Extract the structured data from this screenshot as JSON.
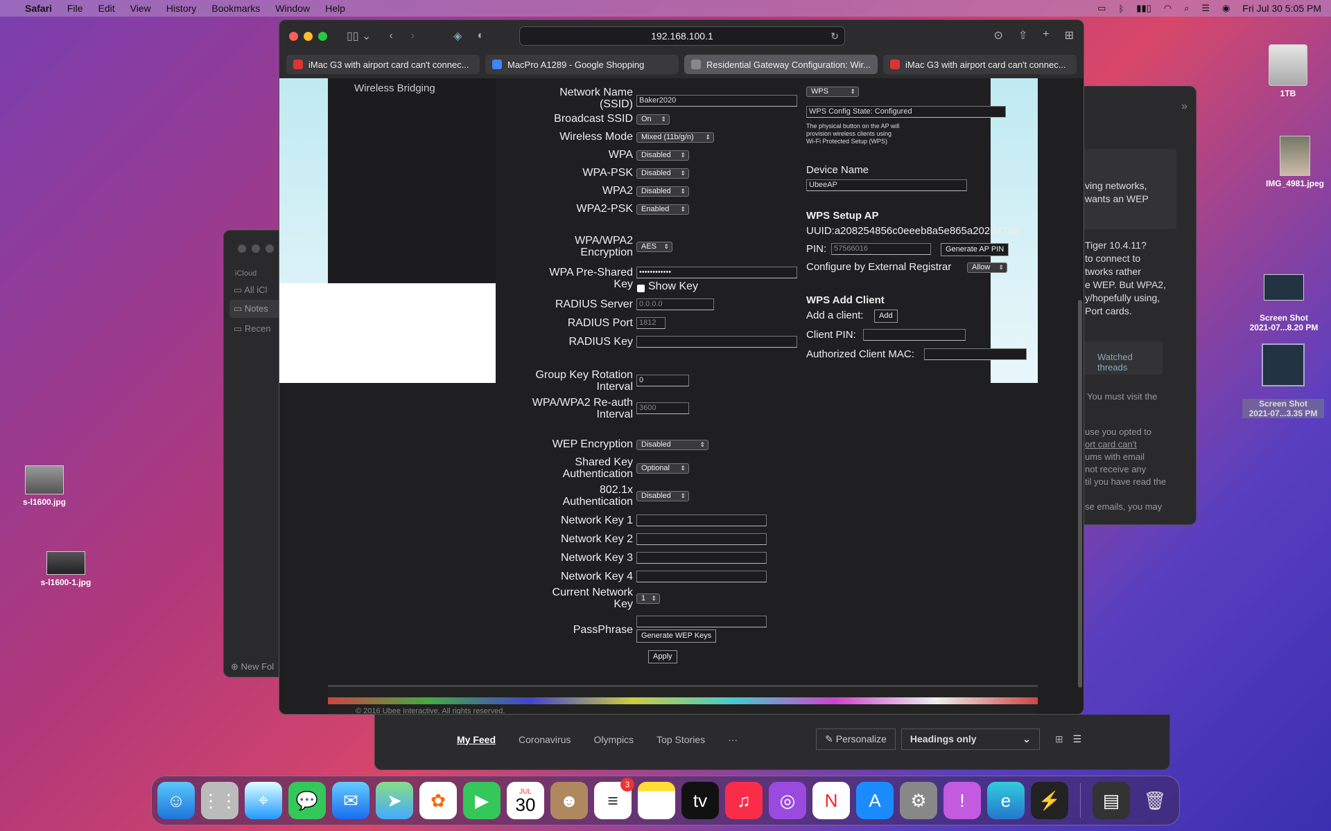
{
  "menubar": {
    "app": "Safari",
    "items": [
      "File",
      "Edit",
      "View",
      "History",
      "Bookmarks",
      "Window",
      "Help"
    ],
    "clock": "Fri Jul 30  5:05 PM"
  },
  "desktop": {
    "icons": [
      {
        "label": "1TB"
      },
      {
        "label": "IMG_4981.jpeg"
      },
      {
        "label": "Screen Shot\n2021-07...8.20 PM"
      },
      {
        "label": "Screen Shot\n2021-07...3.35 PM"
      },
      {
        "label": "s-l1600.jpg"
      },
      {
        "label": "s-l1600-1.jpg"
      }
    ]
  },
  "notes_window": {
    "section": "iCloud",
    "items": [
      "All iCl",
      "Notes",
      "Recen"
    ],
    "new_folder": "New Fol"
  },
  "forum_window": {
    "lines": [
      "ving networks,",
      "wants an WEP",
      "Tiger 10.4.11?",
      "to connect to",
      "tworks rather",
      "e WEP. But WPA2,",
      "y/hopefully using,",
      "Port cards.",
      "Watched threads",
      ". You must visit the",
      "use you opted to",
      "ort card can't",
      "ums with email",
      "not receive any",
      "til you have read the",
      "se emails, you may"
    ]
  },
  "safari": {
    "url": "192.168.100.1",
    "tabs": [
      {
        "title": "iMac G3 with airport card can't connec...",
        "fav": "#d33"
      },
      {
        "title": "MacPro A1289 - Google Shopping",
        "fav": "#4285f4"
      },
      {
        "title": "Residential Gateway Configuration: Wir...",
        "fav": "#888",
        "active": true
      },
      {
        "title": "iMac G3 with airport card can't connec...",
        "fav": "#d33"
      }
    ]
  },
  "page": {
    "nav_item": "Wireless Bridging",
    "left": {
      "ssid_label": "Network Name\n(SSID)",
      "ssid_value": "Baker2020",
      "broadcast_label": "Broadcast SSID",
      "broadcast_value": "On",
      "mode_label": "Wireless Mode",
      "mode_value": "Mixed (11b/g/n)",
      "wpa_label": "WPA",
      "wpa_value": "Disabled",
      "wpapsk_label": "WPA-PSK",
      "wpapsk_value": "Disabled",
      "wpa2_label": "WPA2",
      "wpa2_value": "Disabled",
      "wpa2psk_label": "WPA2-PSK",
      "wpa2psk_value": "Enabled",
      "enc_label": "WPA/WPA2\nEncryption",
      "enc_value": "AES",
      "psk_label": "WPA Pre-Shared\nKey",
      "psk_value": "••••••••••••",
      "show_key": "Show Key",
      "radius_server_label": "RADIUS Server",
      "radius_server_value": "0.0.0.0",
      "radius_port_label": "RADIUS Port",
      "radius_port_value": "1812",
      "radius_key_label": "RADIUS Key",
      "gkr_label": "Group Key Rotation\nInterval",
      "gkr_value": "0",
      "reauth_label": "WPA/WPA2 Re-auth\nInterval",
      "reauth_value": "3600",
      "wep_label": "WEP Encryption",
      "wep_value": "Disabled",
      "ska_label": "Shared Key\nAuthentication",
      "ska_value": "Optional",
      "x8021_label": "802.1x\nAuthentication",
      "x8021_value": "Disabled",
      "nk1": "Network Key 1",
      "nk2": "Network Key 2",
      "nk3": "Network Key 3",
      "nk4": "Network Key 4",
      "cur_label": "Current Network\nKey",
      "cur_value": "1",
      "pass_label": "PassPhrase",
      "gen_wep": "Generate WEP Keys",
      "apply": "Apply"
    },
    "right": {
      "wps_select": "WPS",
      "wps_state": "WPS Config State: Configured",
      "wps_note": "The physical button on the AP will\nprovision wireless clients using\nWi-Fi Protected Setup (WPS)",
      "device_name_label": "Device Name",
      "device_name_value": "UbeeAP",
      "wps_setup_head": "WPS Setup AP",
      "uuid": "UUID:a208254856c0eeeb8a5e865a202d474b",
      "pin_label": "PIN:",
      "pin_value": "57566016",
      "gen_ap_pin": "Generate AP PIN",
      "ext_reg_label": "Configure by External Registrar",
      "ext_reg_value": "Allow",
      "add_client_head": "WPS Add Client",
      "add_client_label": "Add a client:",
      "add_btn": "Add",
      "client_pin_label": "Client PIN:",
      "auth_mac_label": "Authorized Client MAC:"
    },
    "footer": "© 2016 Ubee Interactive. All rights reserved."
  },
  "news": {
    "tabs": [
      "My Feed",
      "Coronavirus",
      "Olympics",
      "Top Stories",
      "···"
    ],
    "personalize": "Personalize",
    "headings": "Headings only"
  },
  "dock": {
    "calendar_month": "JUL",
    "calendar_day": "30",
    "reminders_badge": "3"
  }
}
